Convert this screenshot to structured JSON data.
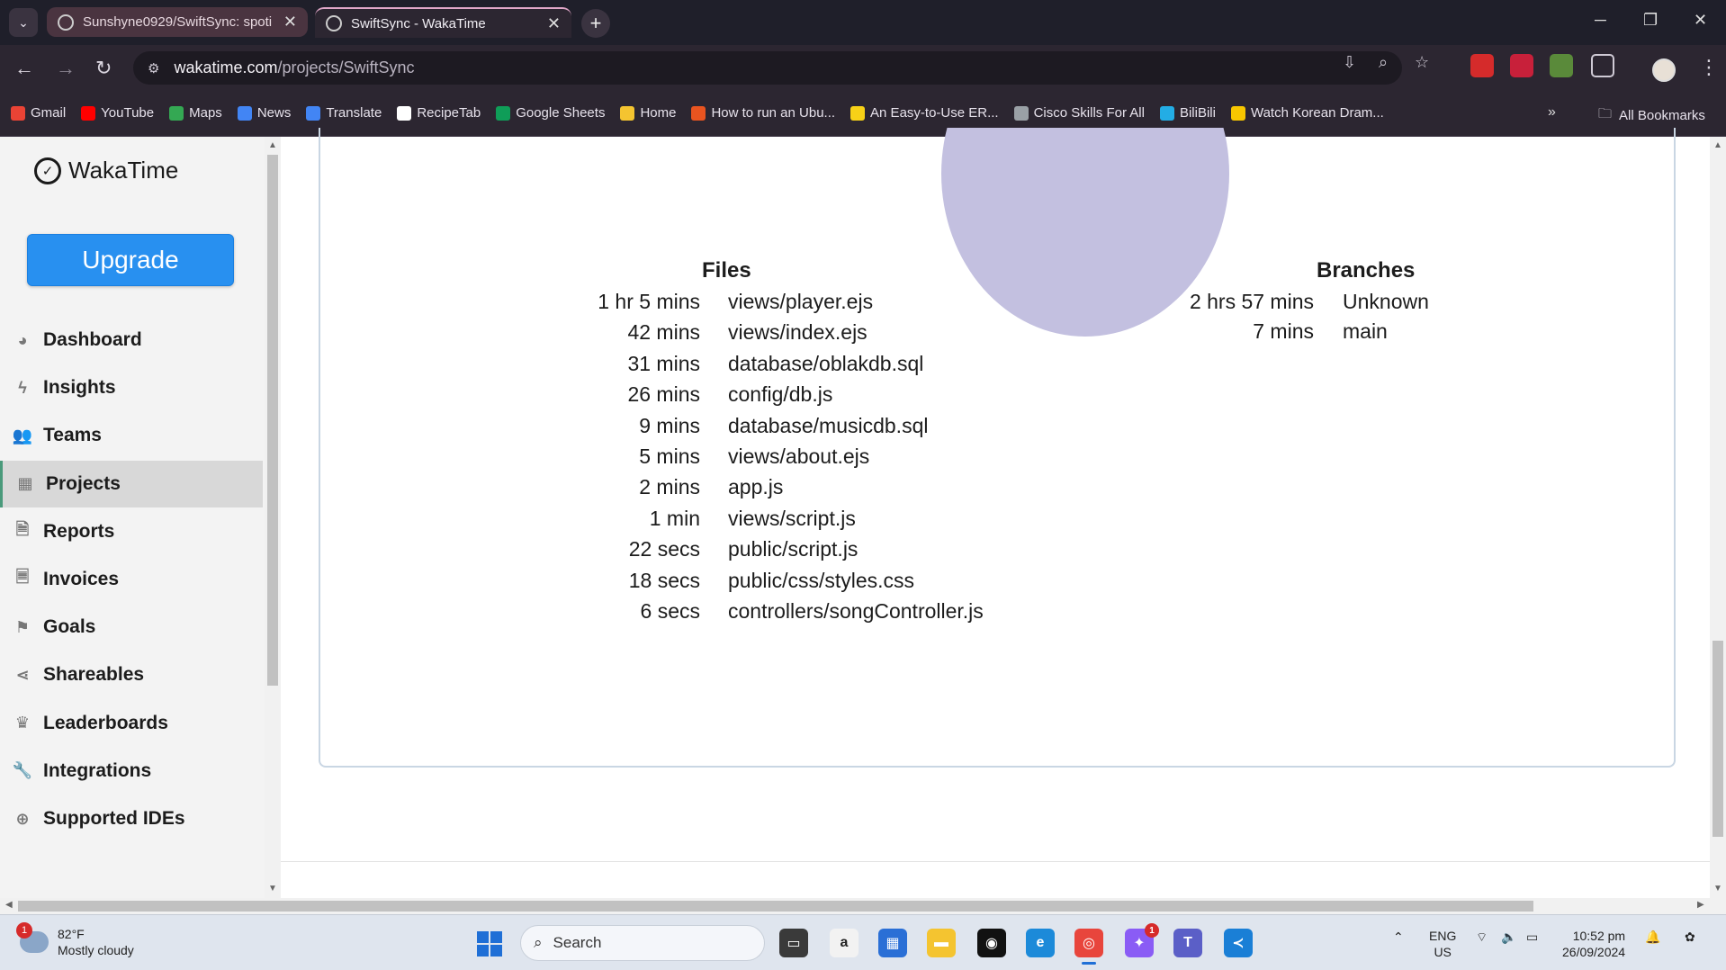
{
  "browser": {
    "tabs": [
      {
        "title": "Sunshyne0929/SwiftSync: spoti",
        "active": false
      },
      {
        "title": "SwiftSync - WakaTime",
        "active": true
      }
    ],
    "url_host": "wakatime.com",
    "url_path": "/projects/SwiftSync",
    "bookmarks": [
      {
        "label": "Gmail",
        "color": "#ea4335"
      },
      {
        "label": "YouTube",
        "color": "#ff0000"
      },
      {
        "label": "Maps",
        "color": "#34a853"
      },
      {
        "label": "News",
        "color": "#4285f4"
      },
      {
        "label": "Translate",
        "color": "#4285f4"
      },
      {
        "label": "RecipeTab",
        "color": "#ffffff"
      },
      {
        "label": "Google Sheets",
        "color": "#0f9d58"
      },
      {
        "label": "Home",
        "color": "#f4c430"
      },
      {
        "label": "How to run an Ubu...",
        "color": "#e95420"
      },
      {
        "label": "An Easy-to-Use ER...",
        "color": "#f7d117"
      },
      {
        "label": "Cisco Skills For All",
        "color": "#9aa0a6"
      },
      {
        "label": "BiliBili",
        "color": "#23ade5"
      },
      {
        "label": "Watch Korean Dram...",
        "color": "#f7c600"
      }
    ],
    "all_bookmarks": "All Bookmarks"
  },
  "sidebar": {
    "brand": "WakaTime",
    "upgrade": "Upgrade",
    "items": [
      {
        "label": "Dashboard",
        "icon": "palette-icon",
        "glyph": "◕"
      },
      {
        "label": "Insights",
        "icon": "bolt-icon",
        "glyph": "ϟ"
      },
      {
        "label": "Teams",
        "icon": "users-icon",
        "glyph": "👥"
      },
      {
        "label": "Projects",
        "icon": "grid-icon",
        "glyph": "▦",
        "active": true
      },
      {
        "label": "Reports",
        "icon": "file-pdf-icon",
        "glyph": "🗎"
      },
      {
        "label": "Invoices",
        "icon": "file-text-icon",
        "glyph": "🗏"
      },
      {
        "label": "Goals",
        "icon": "flag-icon",
        "glyph": "⚑"
      },
      {
        "label": "Shareables",
        "icon": "share-icon",
        "glyph": "⋖"
      },
      {
        "label": "Leaderboards",
        "icon": "trophy-icon",
        "glyph": "♛"
      },
      {
        "label": "Integrations",
        "icon": "wrench-icon",
        "glyph": "🔧"
      },
      {
        "label": "Supported IDEs",
        "icon": "plus-circle-icon",
        "glyph": "⊕"
      }
    ]
  },
  "files": {
    "title": "Files",
    "rows": [
      {
        "duration": "1 hr 5 mins",
        "name": "views/player.ejs"
      },
      {
        "duration": "42 mins",
        "name": "views/index.ejs"
      },
      {
        "duration": "31 mins",
        "name": "database/oblakdb.sql"
      },
      {
        "duration": "26 mins",
        "name": "config/db.js"
      },
      {
        "duration": "9 mins",
        "name": "database/musicdb.sql"
      },
      {
        "duration": "5 mins",
        "name": "views/about.ejs"
      },
      {
        "duration": "2 mins",
        "name": "app.js"
      },
      {
        "duration": "1 min",
        "name": "views/script.js"
      },
      {
        "duration": "22 secs",
        "name": "public/script.js"
      },
      {
        "duration": "18 secs",
        "name": "public/css/styles.css"
      },
      {
        "duration": "6 secs",
        "name": "controllers/songController.js"
      }
    ]
  },
  "branches": {
    "title": "Branches",
    "rows": [
      {
        "duration": "2 hrs 57 mins",
        "name": "Unknown"
      },
      {
        "duration": "7 mins",
        "name": "main"
      }
    ]
  },
  "taskbar": {
    "weather_temp": "82°F",
    "weather_desc": "Mostly cloudy",
    "weather_badge": "1",
    "search_placeholder": "Search",
    "lang_1": "ENG",
    "lang_2": "US",
    "time": "10:52 pm",
    "date": "26/09/2024",
    "messenger_badge": "1"
  }
}
